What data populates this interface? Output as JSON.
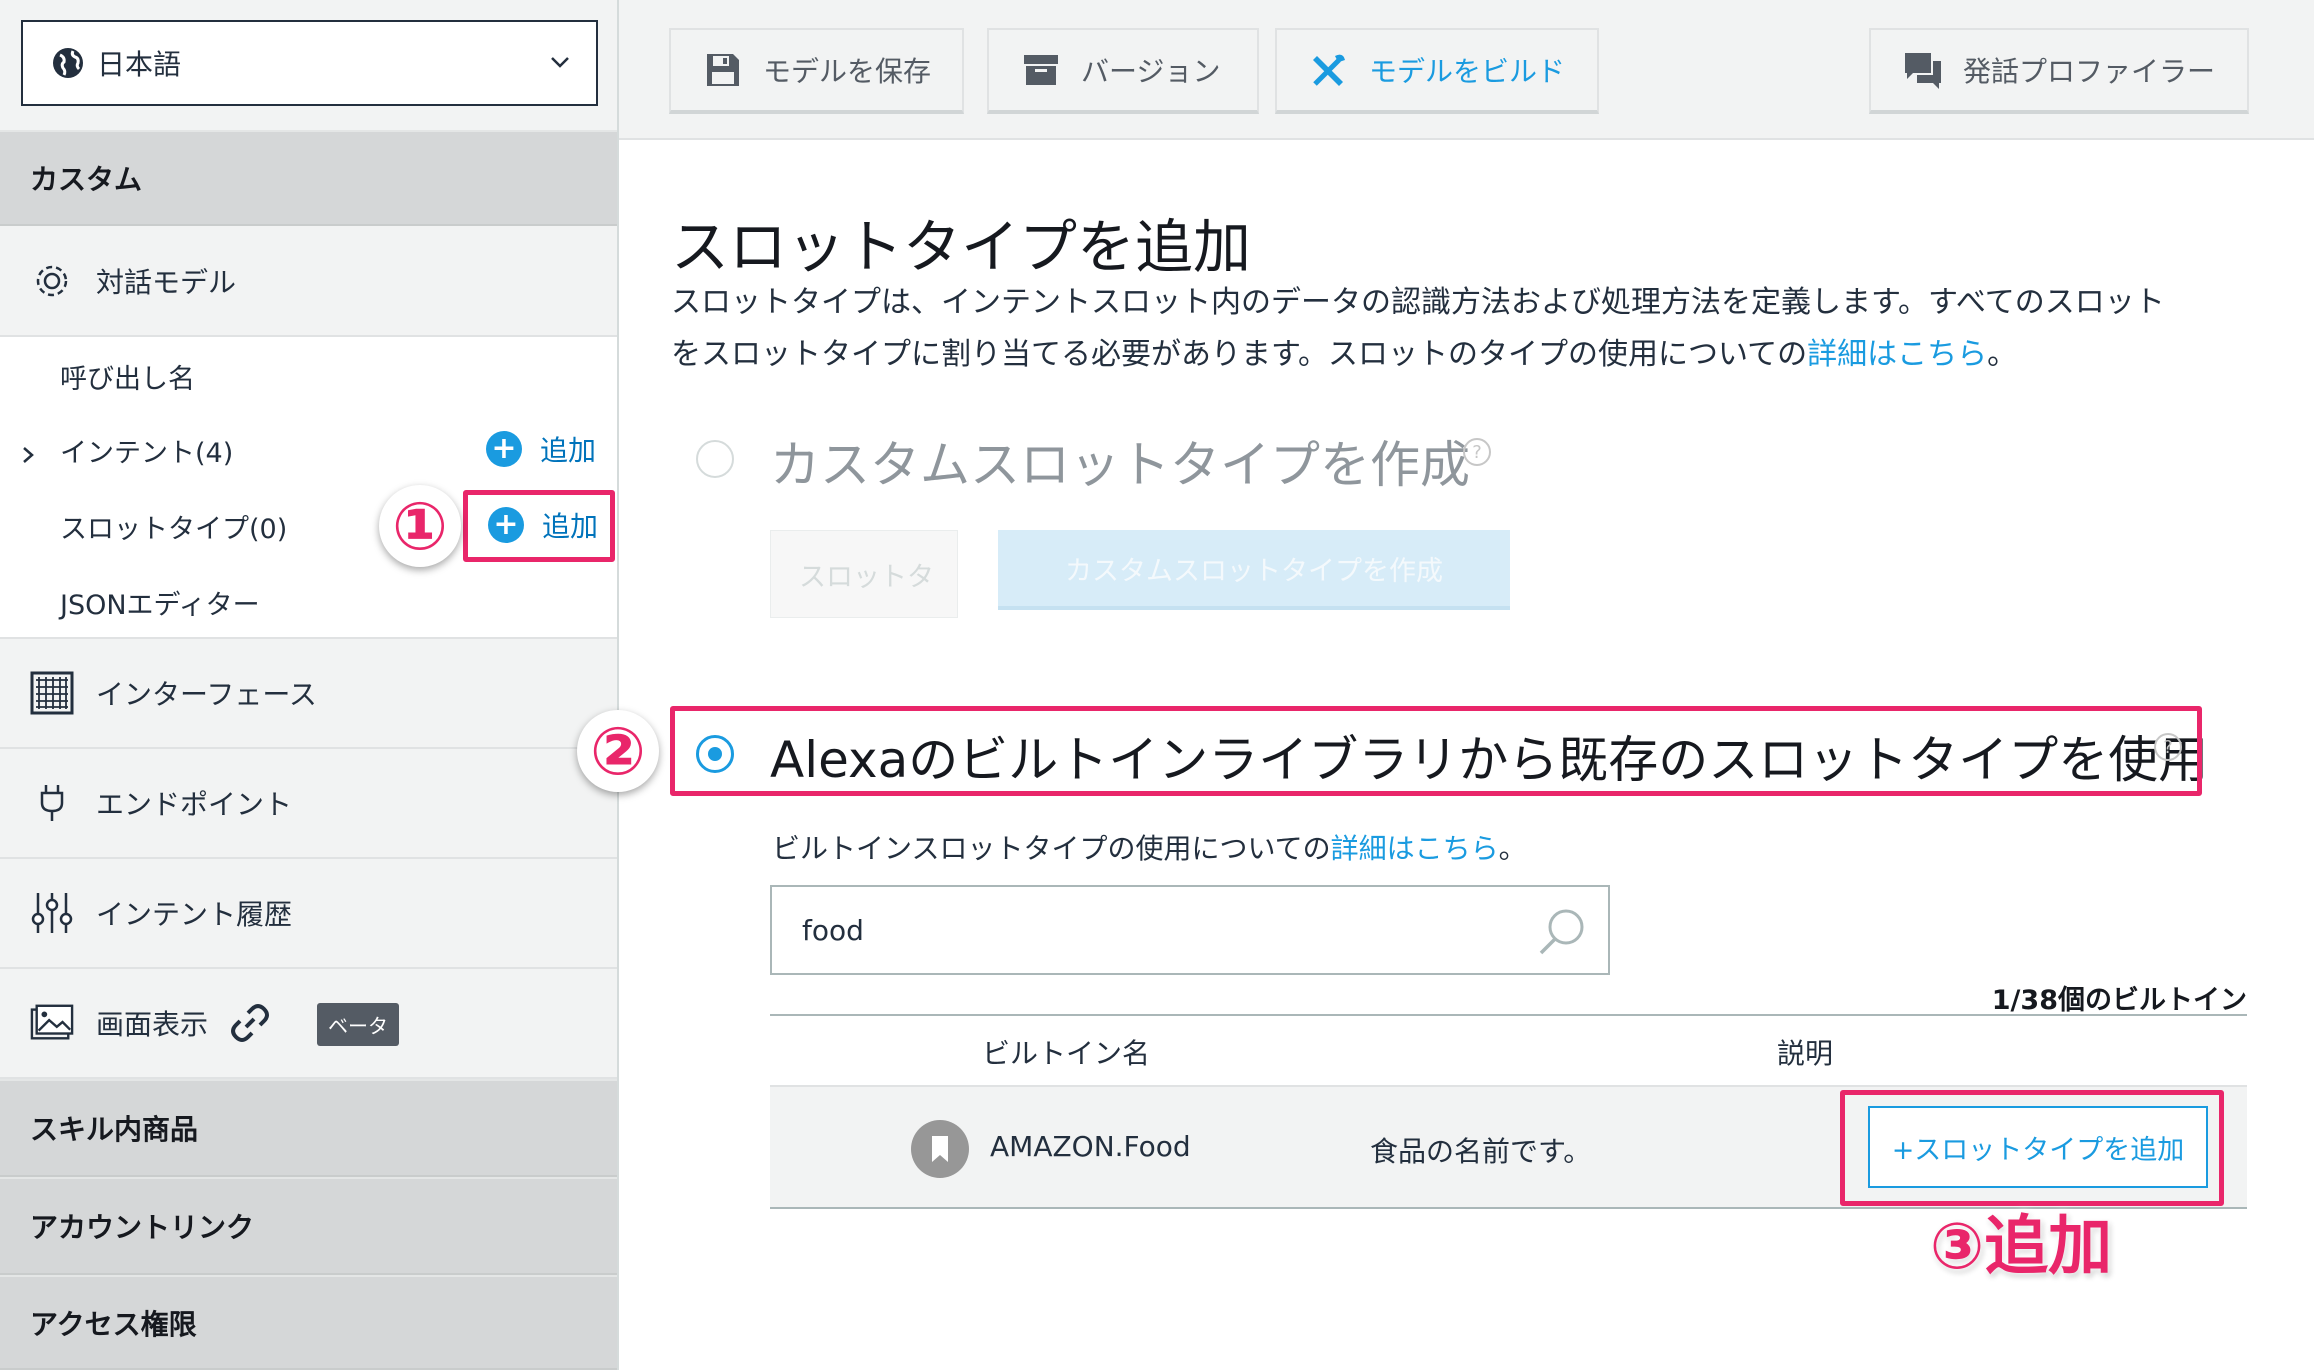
{
  "sidebar": {
    "language": "日本語",
    "section_custom": "カスタム",
    "nav_dialog_model": "対話モデル",
    "sub_items": {
      "invocation": "呼び出し名",
      "intents": "インテント(4)",
      "slot_types": "スロットタイプ(0)",
      "json_editor": "JSONエディター"
    },
    "add_label": "追加",
    "nav_interfaces": "インターフェース",
    "nav_endpoint": "エンドポイント",
    "nav_intent_history": "インテント履歴",
    "nav_display": "画面表示",
    "beta_badge": "ベータ",
    "section_isp": "スキル内商品",
    "section_account_linking": "アカウントリンク",
    "section_permissions": "アクセス権限"
  },
  "toolbar": {
    "save_model": "モデルを保存",
    "versions": "バージョン",
    "build_model": "モデルをビルド",
    "utterance_profiler": "発話プロファイラー"
  },
  "main": {
    "title": "スロットタイプを追加",
    "description_line1": "スロットタイプは、インテントスロット内のデータの認識方法および処理方法を定義します。すべてのスロット",
    "description_line2_pre": "をスロットタイプに割り当てる必要があります。スロットのタイプの使用についての",
    "details_link": "詳細はこちら",
    "period": "。",
    "option_custom": "カスタムスロットタイプを作成",
    "custom_input_placeholder": "スロットタ",
    "custom_create_button": "カスタムスロットタイプを作成",
    "option_builtin": "Alexaのビルトインライブラリから既存のスロットタイプを使用",
    "builtin_desc_pre": "ビルトインスロットタイプの使用についての",
    "search_value": "food",
    "result_count": "1/38個のビルトイン",
    "table": {
      "headers": [
        "ビルトイン名",
        "説明"
      ],
      "rows": [
        {
          "name": "AMAZON.Food",
          "description": "食品の名前です。",
          "action": "+スロットタイプを追加"
        }
      ]
    },
    "help_glyph": "?"
  },
  "annotations": {
    "step1": "①",
    "step2": "②",
    "step3": "③追加",
    "highlight_color": "#e9266a"
  },
  "colors": {
    "accent": "#1a9be0",
    "sidebar_bg": "#f2f3f3",
    "section_bg": "#d5d7d8"
  }
}
